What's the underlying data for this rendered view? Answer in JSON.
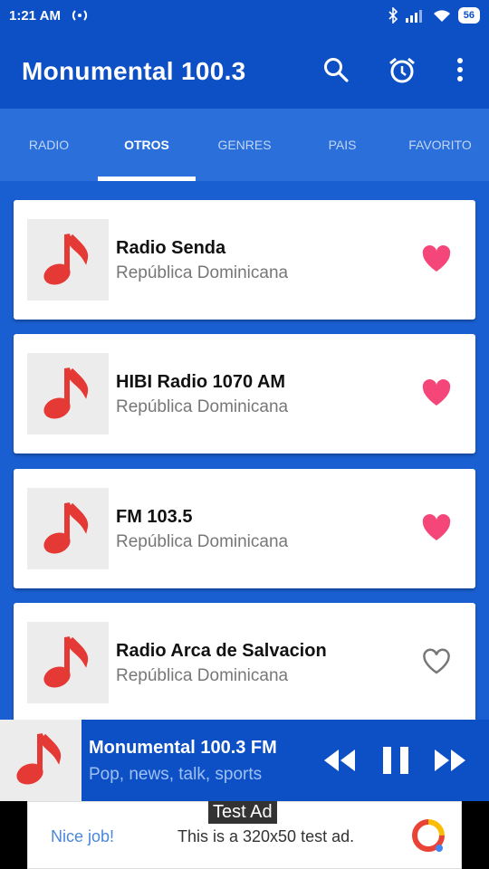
{
  "status_bar": {
    "time": "1:21 AM",
    "battery": "56"
  },
  "app_bar": {
    "title": "Monumental 100.3"
  },
  "tabs": [
    {
      "label": "RADIO"
    },
    {
      "label": "OTROS",
      "active": true
    },
    {
      "label": "GENRES"
    },
    {
      "label": "PAIS"
    },
    {
      "label": "FAVORITO"
    }
  ],
  "stations": [
    {
      "name": "Radio Senda",
      "country": "República Dominicana",
      "favorite": true
    },
    {
      "name": "HIBI Radio 1070 AM",
      "country": "República Dominicana",
      "favorite": true
    },
    {
      "name": "FM 103.5",
      "country": "República Dominicana",
      "favorite": true
    },
    {
      "name": "Radio Arca de Salvacion",
      "country": "República Dominicana",
      "favorite": false
    }
  ],
  "player": {
    "title": "Monumental 100.3 FM",
    "subtitle": "Pop, news, talk, sports"
  },
  "ad": {
    "label": "Test Ad",
    "nice": "Nice job!",
    "text": "This is a 320x50 test ad."
  },
  "colors": {
    "primary": "#0d4fc4",
    "background": "#1a5fd1",
    "heart": "#f5467a",
    "note": "#e53935"
  }
}
